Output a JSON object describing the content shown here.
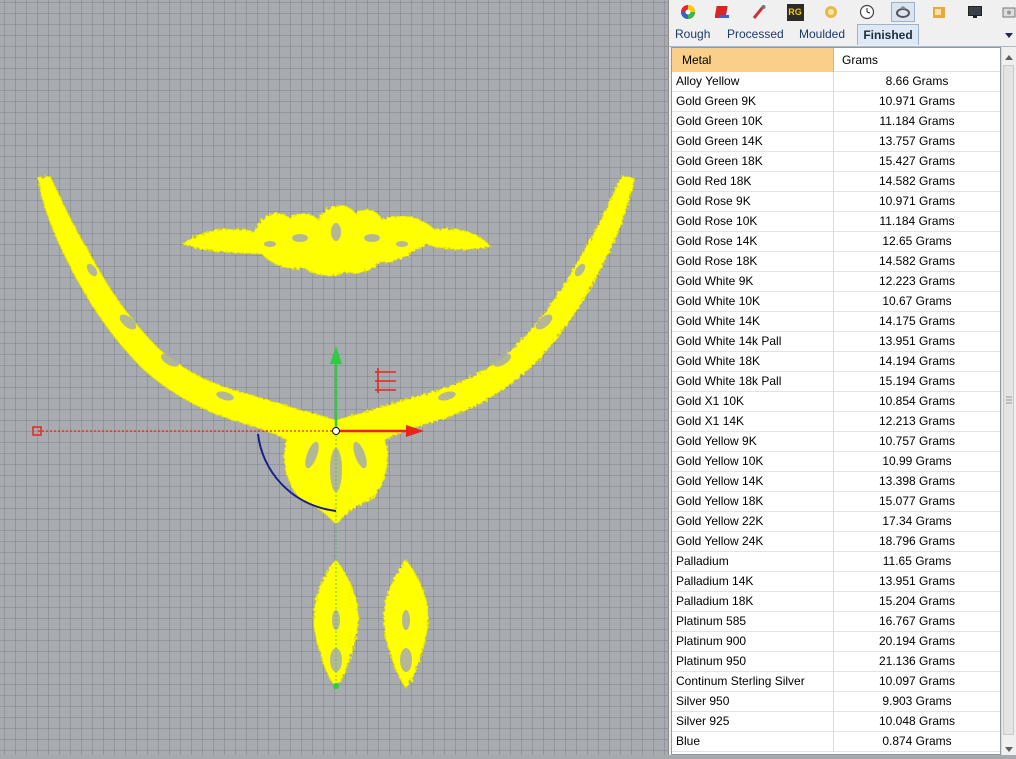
{
  "toolbar": {
    "icons": [
      "color-wheel-icon",
      "book-icon",
      "brush-icon",
      "rg-icon",
      "gem-icon",
      "clock-icon",
      "ring-icon",
      "jewel-box-icon",
      "monitor-icon",
      "settings-icon"
    ],
    "rg_label": "RG"
  },
  "tabs": [
    "Rough",
    "Processed",
    "Moulded",
    "Finished"
  ],
  "selected_tab": "Finished",
  "table": {
    "headers": [
      "Metal",
      "Grams"
    ],
    "rows": [
      {
        "metal": "Alloy Yellow",
        "grams": "8.66 Grams"
      },
      {
        "metal": "Gold Green 9K",
        "grams": "10.971 Grams"
      },
      {
        "metal": "Gold Green 10K",
        "grams": "11.184 Grams"
      },
      {
        "metal": "Gold Green 14K",
        "grams": "13.757 Grams"
      },
      {
        "metal": "Gold Green 18K",
        "grams": "15.427 Grams"
      },
      {
        "metal": "Gold Red 18K",
        "grams": "14.582 Grams"
      },
      {
        "metal": "Gold Rose 9K",
        "grams": "10.971 Grams"
      },
      {
        "metal": "Gold Rose 10K",
        "grams": "11.184 Grams"
      },
      {
        "metal": "Gold Rose 14K",
        "grams": "12.65 Grams"
      },
      {
        "metal": "Gold Rose 18K",
        "grams": "14.582 Grams"
      },
      {
        "metal": "Gold White 9K",
        "grams": "12.223 Grams"
      },
      {
        "metal": "Gold White 10K",
        "grams": "10.67 Grams"
      },
      {
        "metal": "Gold White 14K",
        "grams": "14.175 Grams"
      },
      {
        "metal": "Gold White 14k Pall",
        "grams": "13.951 Grams"
      },
      {
        "metal": "Gold White 18K",
        "grams": "14.194 Grams"
      },
      {
        "metal": "Gold White 18k Pall",
        "grams": "15.194 Grams"
      },
      {
        "metal": "Gold X1 10K",
        "grams": "10.854 Grams"
      },
      {
        "metal": "Gold X1 14K",
        "grams": "12.213 Grams"
      },
      {
        "metal": "Gold Yellow 9K",
        "grams": "10.757 Grams"
      },
      {
        "metal": "Gold Yellow 10K",
        "grams": "10.99 Grams"
      },
      {
        "metal": "Gold Yellow 14K",
        "grams": "13.398 Grams"
      },
      {
        "metal": "Gold Yellow 18K",
        "grams": "15.077 Grams"
      },
      {
        "metal": "Gold Yellow 22K",
        "grams": "17.34 Grams"
      },
      {
        "metal": "Gold Yellow 24K",
        "grams": "18.796 Grams"
      },
      {
        "metal": "Palladium",
        "grams": "11.65 Grams"
      },
      {
        "metal": "Palladium 14K",
        "grams": "13.951 Grams"
      },
      {
        "metal": "Palladium 18K",
        "grams": "15.204 Grams"
      },
      {
        "metal": "Platinum 585",
        "grams": "16.767 Grams"
      },
      {
        "metal": "Platinum 900",
        "grams": "20.194 Grams"
      },
      {
        "metal": "Platinum 950",
        "grams": "21.136 Grams"
      },
      {
        "metal": "Continum Sterling Silver",
        "grams": "10.097 Grams"
      },
      {
        "metal": "Silver 950",
        "grams": "9.903 Grams"
      },
      {
        "metal": "Silver 925",
        "grams": "10.048 Grams"
      },
      {
        "metal": "Blue",
        "grams": "0.874 Grams"
      }
    ]
  },
  "colors": {
    "viewport_bg": "#a8abaf",
    "model_yellow": "#ffff00",
    "header_highlight": "#f9cf89",
    "gumball_x": "#e8251b",
    "gumball_y": "#2ecc40",
    "gumball_rotate": "#1b1f8a"
  }
}
